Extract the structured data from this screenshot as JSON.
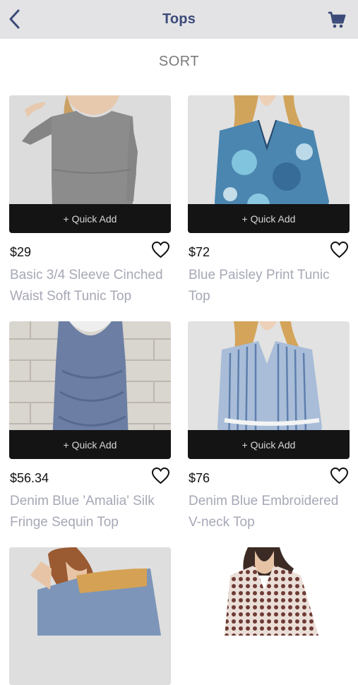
{
  "header": {
    "title": "Tops",
    "back_icon": "chevron-left-icon",
    "cart_icon": "shopping-cart-icon"
  },
  "sort_label": "SORT",
  "colors": {
    "header_bg": "#e3e3e5",
    "title": "#3b4a78",
    "product_name": "#a6a8b6",
    "quick_add_bg": "#141414"
  },
  "products": [
    {
      "price": "$29",
      "name": "Basic 3/4 Sleeve Cinched Waist Soft Tunic Top",
      "quick_add": "+ Quick Add",
      "favorite_icon": "heart-outline-icon"
    },
    {
      "price": "$72",
      "name": "Blue Paisley Print Tunic Top",
      "quick_add": "+ Quick Add",
      "favorite_icon": "heart-outline-icon"
    },
    {
      "price": "$56.34",
      "name": "Denim Blue 'Amalia' Silk Fringe Sequin Top",
      "quick_add": "+ Quick Add",
      "favorite_icon": "heart-outline-icon"
    },
    {
      "price": "$76",
      "name": "Denim Blue Embroidered V-neck Top",
      "quick_add": "+ Quick Add",
      "favorite_icon": "heart-outline-icon"
    },
    {
      "price": "",
      "name": "",
      "quick_add": "",
      "favorite_icon": ""
    },
    {
      "price": "",
      "name": "",
      "quick_add": "",
      "favorite_icon": ""
    }
  ]
}
